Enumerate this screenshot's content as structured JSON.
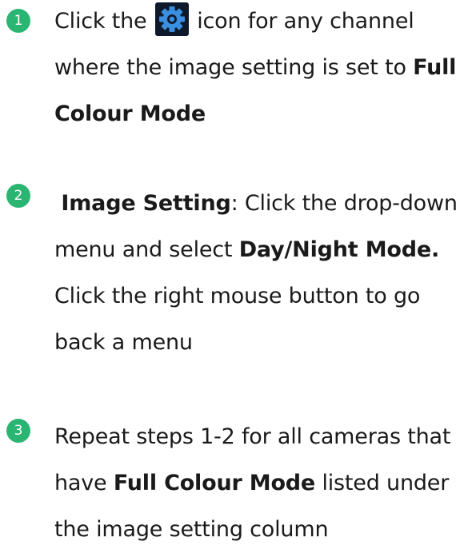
{
  "colors": {
    "badge": "#2bb573",
    "gear_bg": "#0e1a2b",
    "gear_fg": "#3b8fe0"
  },
  "steps": [
    {
      "number": "1",
      "l1_pre": "Click the",
      "l1_post": "icon for any channel",
      "l2_pre": "where the image setting is set to",
      "l2_bold": "Full",
      "l3_bold": "Colour Mode",
      "icon": "gear-icon"
    },
    {
      "number": "2",
      "l1_bold": "Image Setting",
      "l1_post": ": Click the drop-down",
      "l2_pre": "menu and select",
      "l2_bold": "Day/Night Mode.",
      "l3": "Click the right mouse button to go",
      "l4": "back a menu"
    },
    {
      "number": "3",
      "l1": "Repeat steps 1-2 for all cameras that",
      "l2_pre": "have",
      "l2_bold": "Full Colour Mode",
      "l2_post": "listed under",
      "l3": "the image setting column"
    }
  ]
}
